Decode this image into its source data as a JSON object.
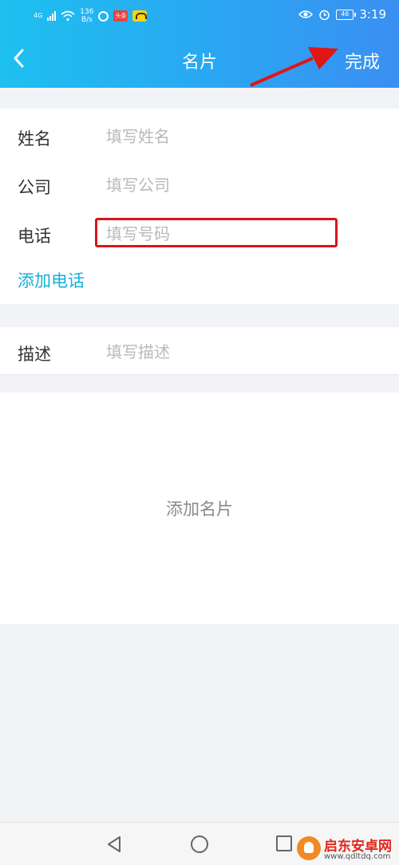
{
  "status_bar": {
    "network": "4G",
    "speed_value": "136",
    "speed_unit": "B/s",
    "badge": "头条",
    "battery": "46",
    "time": "3:19"
  },
  "header": {
    "title": "名片",
    "done_label": "完成"
  },
  "form": {
    "fields": [
      {
        "label": "姓名",
        "placeholder": "填写姓名"
      },
      {
        "label": "公司",
        "placeholder": "填写公司"
      },
      {
        "label": "电话",
        "placeholder": "填写号码"
      }
    ],
    "add_phone_label": "添加电话",
    "description": {
      "label": "描述",
      "placeholder": "填写描述"
    }
  },
  "add_card_label": "添加名片",
  "watermark": {
    "name": "启东安卓网",
    "url": "www.qdltdq.com"
  },
  "colors": {
    "accent": "#14b0d8",
    "header_start": "#1ec0f0",
    "header_end": "#3b8ff2",
    "highlight": "#d9161a"
  }
}
